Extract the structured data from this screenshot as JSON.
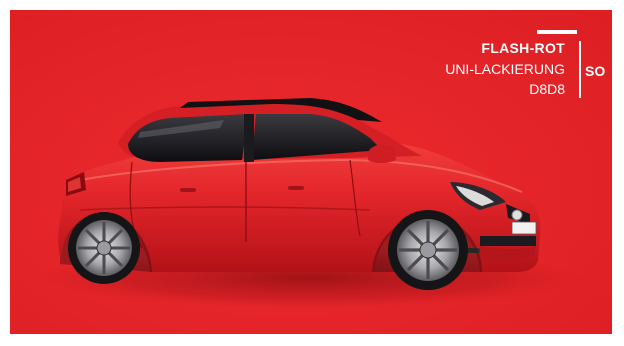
{
  "paint": {
    "name": "FLASH-ROT",
    "finish": "UNI-LACKIERUNG",
    "code": "D8D8",
    "series": "SO"
  },
  "colors": {
    "background": "#e8262a",
    "car_body": "#e4262c",
    "text": "#ffffff"
  },
  "image": {
    "subject": "red-hatchback-car-icon"
  }
}
